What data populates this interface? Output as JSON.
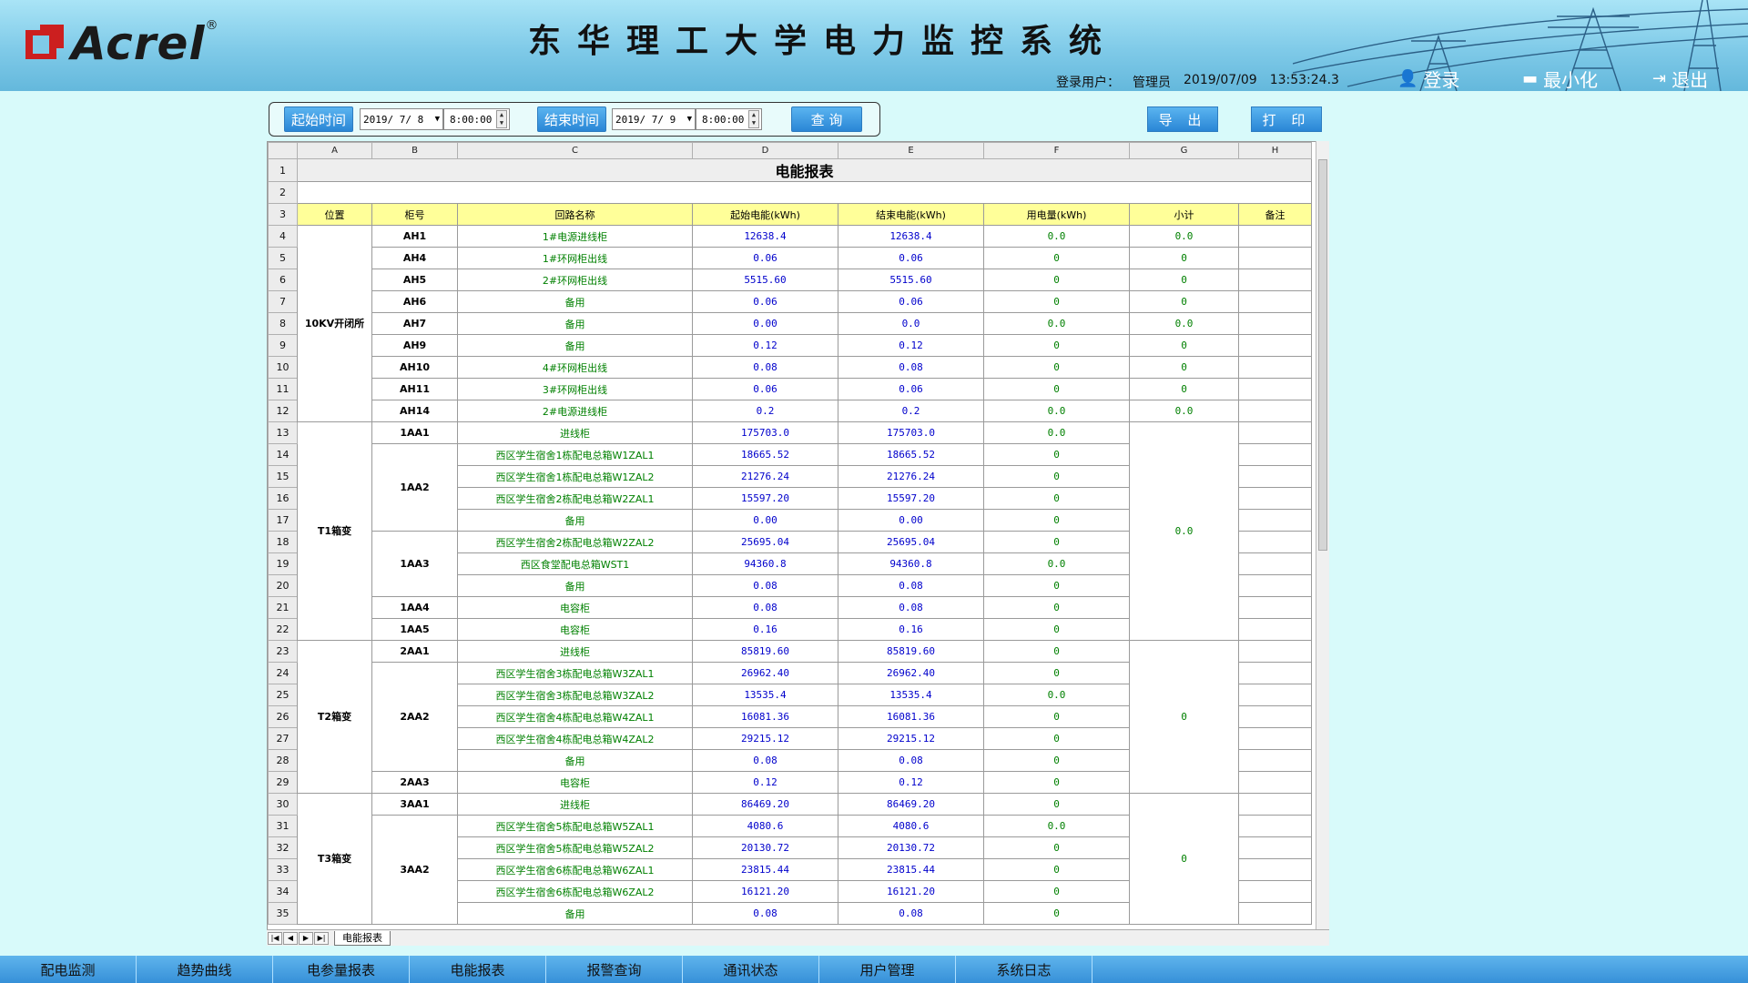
{
  "brand": {
    "name": "Acrel",
    "reg": "®"
  },
  "header": {
    "title": "东华理工大学电力监控系统"
  },
  "user": {
    "label": "登录用户：",
    "name": "管理员",
    "date": "2019/07/09",
    "time": "13:53:24.3"
  },
  "header_buttons": {
    "login": "登录",
    "minimize": "最小化",
    "exit": "退出"
  },
  "query": {
    "start_label": "起始时间",
    "start_date": "2019/ 7/ 8",
    "start_time": "8:00:00",
    "end_label": "结束时间",
    "end_date": "2019/ 7/ 9",
    "end_time": "8:00:00",
    "search": "查 询"
  },
  "actions": {
    "export": "导 出",
    "print": "打 印"
  },
  "sheet": {
    "columns": [
      "A",
      "B",
      "C",
      "D",
      "E",
      "F",
      "G",
      "H"
    ],
    "title": "电能报表",
    "headers": [
      "位置",
      "柜号",
      "回路名称",
      "起始电能(kWh)",
      "结束电能(kWh)",
      "用电量(kWh)",
      "小计",
      "备注"
    ],
    "tab": "电能报表",
    "groups": [
      {
        "loc": "10KV开闭所",
        "subtotal": null
      },
      {
        "loc": "T1箱变",
        "subtotal": "0.0"
      },
      {
        "loc": "T2箱变",
        "subtotal": "0"
      },
      {
        "loc": "T3箱变",
        "subtotal": "0"
      }
    ],
    "rows": [
      {
        "n": "4",
        "cab": "AH1",
        "name": "1#电源进线柜",
        "start": "12638.4",
        "end": "12638.4",
        "use": "0.0",
        "sub": "0.0"
      },
      {
        "n": "5",
        "cab": "AH4",
        "name": "1#环网柜出线",
        "start": "0.06",
        "end": "0.06",
        "use": "0",
        "sub": "0"
      },
      {
        "n": "6",
        "cab": "AH5",
        "name": "2#环网柜出线",
        "start": "5515.60",
        "end": "5515.60",
        "use": "0",
        "sub": "0"
      },
      {
        "n": "7",
        "cab": "AH6",
        "name": "备用",
        "start": "0.06",
        "end": "0.06",
        "use": "0",
        "sub": "0"
      },
      {
        "n": "8",
        "cab": "AH7",
        "name": "备用",
        "start": "0.00",
        "end": "0.0",
        "use": "0.0",
        "sub": "0.0"
      },
      {
        "n": "9",
        "cab": "AH9",
        "name": "备用",
        "start": "0.12",
        "end": "0.12",
        "use": "0",
        "sub": "0"
      },
      {
        "n": "10",
        "cab": "AH10",
        "name": "4#环网柜出线",
        "start": "0.08",
        "end": "0.08",
        "use": "0",
        "sub": "0"
      },
      {
        "n": "11",
        "cab": "AH11",
        "name": "3#环网柜出线",
        "start": "0.06",
        "end": "0.06",
        "use": "0",
        "sub": "0"
      },
      {
        "n": "12",
        "cab": "AH14",
        "name": "2#电源进线柜",
        "start": "0.2",
        "end": "0.2",
        "use": "0.0",
        "sub": "0.0"
      },
      {
        "n": "13",
        "cab": "1AA1",
        "name": "进线柜",
        "start": "175703.0",
        "end": "175703.0",
        "use": "0.0"
      },
      {
        "n": "14",
        "cab": "1AA2",
        "name": "西区学生宿舍1栋配电总箱W1ZAL1",
        "start": "18665.52",
        "end": "18665.52",
        "use": "0"
      },
      {
        "n": "15",
        "cab": "",
        "name": "西区学生宿舍1栋配电总箱W1ZAL2",
        "start": "21276.24",
        "end": "21276.24",
        "use": "0"
      },
      {
        "n": "16",
        "cab": "",
        "name": "西区学生宿舍2栋配电总箱W2ZAL1",
        "start": "15597.20",
        "end": "15597.20",
        "use": "0"
      },
      {
        "n": "17",
        "cab": "",
        "name": "备用",
        "start": "0.00",
        "end": "0.00",
        "use": "0"
      },
      {
        "n": "18",
        "cab": "1AA3",
        "name": "西区学生宿舍2栋配电总箱W2ZAL2",
        "start": "25695.04",
        "end": "25695.04",
        "use": "0"
      },
      {
        "n": "19",
        "cab": "",
        "name": "西区食堂配电总箱WST1",
        "start": "94360.8",
        "end": "94360.8",
        "use": "0.0"
      },
      {
        "n": "20",
        "cab": "",
        "name": "备用",
        "start": "0.08",
        "end": "0.08",
        "use": "0"
      },
      {
        "n": "21",
        "cab": "1AA4",
        "name": "电容柜",
        "start": "0.08",
        "end": "0.08",
        "use": "0"
      },
      {
        "n": "22",
        "cab": "1AA5",
        "name": "电容柜",
        "start": "0.16",
        "end": "0.16",
        "use": "0"
      },
      {
        "n": "23",
        "cab": "2AA1",
        "name": "进线柜",
        "start": "85819.60",
        "end": "85819.60",
        "use": "0"
      },
      {
        "n": "24",
        "cab": "2AA2",
        "name": "西区学生宿舍3栋配电总箱W3ZAL1",
        "start": "26962.40",
        "end": "26962.40",
        "use": "0"
      },
      {
        "n": "25",
        "cab": "",
        "name": "西区学生宿舍3栋配电总箱W3ZAL2",
        "start": "13535.4",
        "end": "13535.4",
        "use": "0.0"
      },
      {
        "n": "26",
        "cab": "",
        "name": "西区学生宿舍4栋配电总箱W4ZAL1",
        "start": "16081.36",
        "end": "16081.36",
        "use": "0"
      },
      {
        "n": "27",
        "cab": "",
        "name": "西区学生宿舍4栋配电总箱W4ZAL2",
        "start": "29215.12",
        "end": "29215.12",
        "use": "0"
      },
      {
        "n": "28",
        "cab": "",
        "name": "备用",
        "start": "0.08",
        "end": "0.08",
        "use": "0"
      },
      {
        "n": "29",
        "cab": "2AA3",
        "name": "电容柜",
        "start": "0.12",
        "end": "0.12",
        "use": "0"
      },
      {
        "n": "30",
        "cab": "3AA1",
        "name": "进线柜",
        "start": "86469.20",
        "end": "86469.20",
        "use": "0"
      },
      {
        "n": "31",
        "cab": "3AA2",
        "name": "西区学生宿舍5栋配电总箱W5ZAL1",
        "start": "4080.6",
        "end": "4080.6",
        "use": "0.0"
      },
      {
        "n": "32",
        "cab": "",
        "name": "西区学生宿舍5栋配电总箱W5ZAL2",
        "start": "20130.72",
        "end": "20130.72",
        "use": "0"
      },
      {
        "n": "33",
        "cab": "",
        "name": "西区学生宿舍6栋配电总箱W6ZAL1",
        "start": "23815.44",
        "end": "23815.44",
        "use": "0"
      },
      {
        "n": "34",
        "cab": "",
        "name": "西区学生宿舍6栋配电总箱W6ZAL2",
        "start": "16121.20",
        "end": "16121.20",
        "use": "0"
      },
      {
        "n": "35",
        "cab": "",
        "name": "备用",
        "start": "0.08",
        "end": "0.08",
        "use": "0"
      }
    ]
  },
  "nav": [
    "配电监测",
    "趋势曲线",
    "电参量报表",
    "电能报表",
    "报警查询",
    "通讯状态",
    "用户管理",
    "系统日志"
  ],
  "colors": {
    "header_bg": "#7fcae8",
    "page_bg": "#d8fafa",
    "button": "#2a86d6",
    "header_row": "#ffff99",
    "value_blue": "#0000cc",
    "value_green": "#008000",
    "logo_red": "#cc1f1f"
  }
}
